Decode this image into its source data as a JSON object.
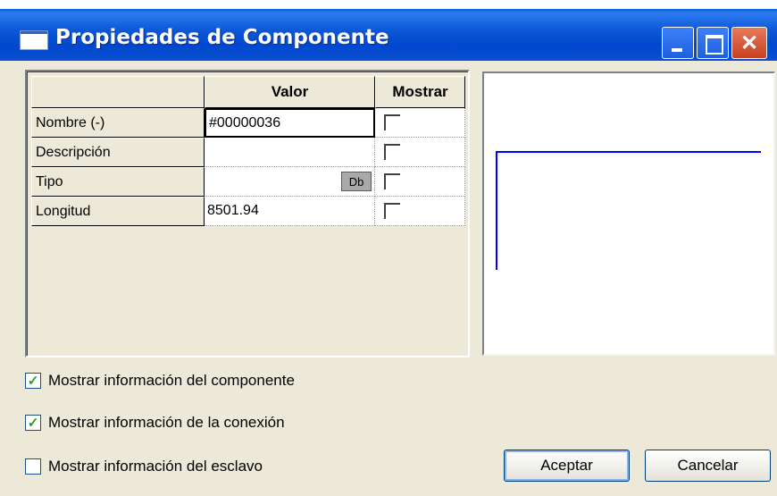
{
  "window": {
    "title": "Propiedades de Componente",
    "buttons": {
      "minimize": "minimize-icon",
      "maximize": "maximize-icon",
      "close": "close-icon"
    }
  },
  "grid": {
    "headers": {
      "name": "",
      "value": "Valor",
      "show": "Mostrar"
    },
    "rows": [
      {
        "label": "Nombre (-)",
        "value": "#00000036",
        "show": false
      },
      {
        "label": "Descripción",
        "value": "",
        "show": false
      },
      {
        "label": "Tipo",
        "value": "",
        "button": "Db",
        "show": false
      },
      {
        "label": "Longitud",
        "value": "8501.94",
        "show": false
      }
    ]
  },
  "options": [
    {
      "label": "Mostrar información del componente",
      "checked": true
    },
    {
      "label": "Mostrar información de la conexión",
      "checked": true
    },
    {
      "label": "Mostrar información del esclavo",
      "checked": false
    }
  ],
  "buttons": {
    "ok": "Aceptar",
    "cancel": "Cancelar"
  },
  "colors": {
    "preview_line": "#0000ff",
    "check": "#21a121",
    "titlebar": "#0048cf"
  }
}
